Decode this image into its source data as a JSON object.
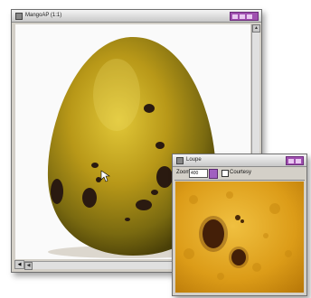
{
  "main_window": {
    "title": "MangoAP (1:1)",
    "icon": "document-icon",
    "status_symbol": "◀",
    "scroll_up": "▲",
    "scroll_down": "▼",
    "scroll_left": "◀",
    "scroll_right": "▶"
  },
  "loupe_window": {
    "title": "Loupe",
    "zoom_label": "Zoom",
    "zoom_value": "400",
    "checkbox_label": "Courtesy",
    "checkbox_checked": false
  },
  "colors": {
    "accent": "#a050b0",
    "fruit_body": "#b09010",
    "fruit_highlight": "#d8c030",
    "spots": "#2a1a10",
    "loupe_bg": "#e0a020"
  }
}
